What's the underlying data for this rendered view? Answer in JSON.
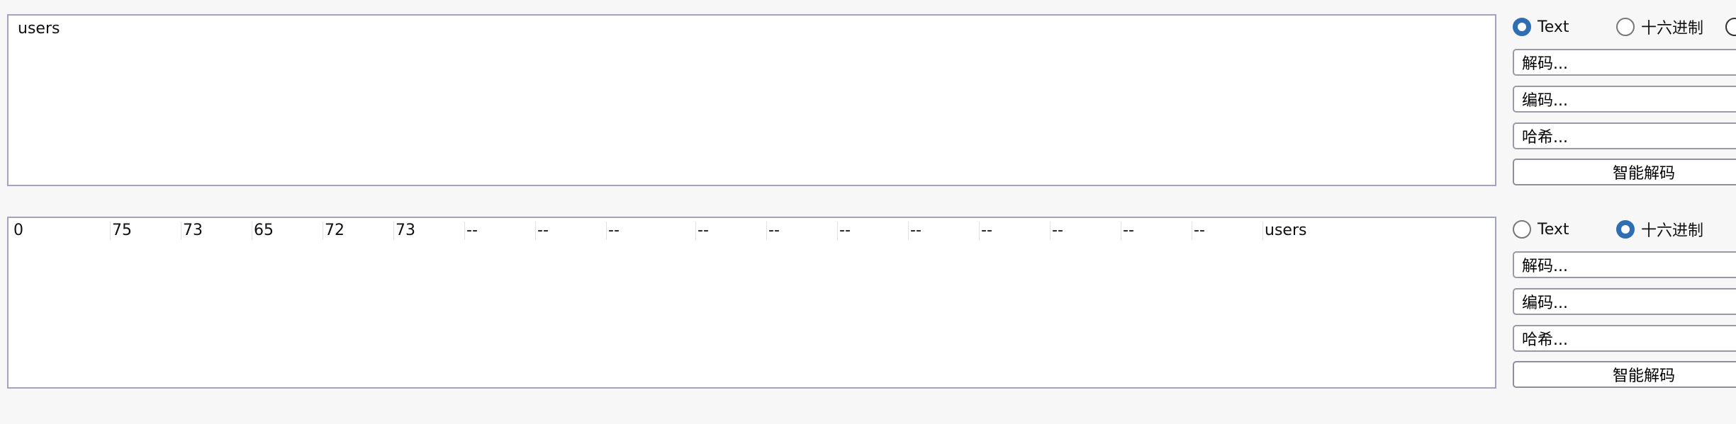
{
  "top_panel": {
    "text": "users",
    "radio_text_label": "Text",
    "radio_hex_label": "十六进制",
    "selected": "text",
    "decode_label": "解码...",
    "encode_label": "编码...",
    "hash_label": "哈希...",
    "smart_decode_label": "智能解码"
  },
  "bottom_panel": {
    "hex_row": {
      "offset": "0",
      "bytes": [
        "75",
        "73",
        "65",
        "72",
        "73",
        "--",
        "--",
        "--",
        "--",
        "--",
        "--",
        "--",
        "--",
        "--",
        "--",
        "--"
      ],
      "ascii": "users"
    },
    "radio_text_label": "Text",
    "radio_hex_label": "十六进制",
    "selected": "hex",
    "decode_label": "解码...",
    "encode_label": "编码...",
    "hash_label": "哈希...",
    "smart_decode_label": "智能解码"
  },
  "colors": {
    "radio_selected": "#2f6eb3",
    "border": "#a3a3bf",
    "background": "#f7f7f7"
  }
}
